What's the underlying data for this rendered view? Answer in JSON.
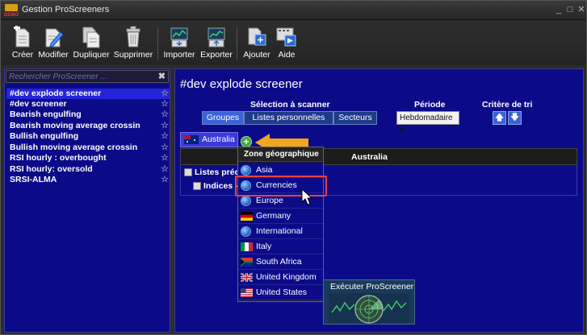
{
  "window": {
    "title": "Gestion ProScreeners",
    "logo_text": "DEMO",
    "minimize_glyph": "_",
    "maximize_glyph": "□",
    "close_glyph": "✕"
  },
  "toolbar": {
    "create": "Créer",
    "modify": "Modifier",
    "duplicate": "Dupliquer",
    "delete": "Supprimer",
    "import": "Importer",
    "export": "Exporter",
    "add": "Ajouter",
    "help": "Aide"
  },
  "search": {
    "placeholder": "Rechercher ProScreener ...",
    "clear_glyph": "✖"
  },
  "screeners": [
    "#dev explode screener",
    "#dev screener",
    "Bearish engulfing",
    "Bearish moving average crossin",
    "Bullish engulfing",
    "Bullish moving average crossin",
    "RSI hourly : overbought",
    "RSI hourly: oversold",
    "SRSI-ALMA"
  ],
  "star_glyph": "☆",
  "main": {
    "title": "#dev explode screener",
    "selection_label": "Sélection à scanner",
    "tabs": [
      "Groupes",
      "Listes personnelles",
      "Secteurs"
    ],
    "period_label": "Période",
    "period_value": "Hebdomadaire",
    "period_caret": "▾",
    "sort_label": "Critère de tri",
    "sort_up_glyph": "🡅",
    "sort_down_glyph": "🡇",
    "active_tab": "Australia",
    "add_glyph": "+",
    "grid_header": "Australia",
    "row1": "Listes préd",
    "row2": "Indices -"
  },
  "dropdown": {
    "header": "Zone géographique",
    "items": [
      "Asia",
      "Currencies",
      "Europe",
      "Germany",
      "International",
      "Italy",
      "South Africa",
      "United Kingdom",
      "United States"
    ]
  },
  "execute": {
    "label": "Exécuter ProScreener"
  },
  "colors": {
    "panel_bg": "#0b0b8a",
    "highlight": "#e8443c",
    "arrow": "#f2a51f"
  }
}
